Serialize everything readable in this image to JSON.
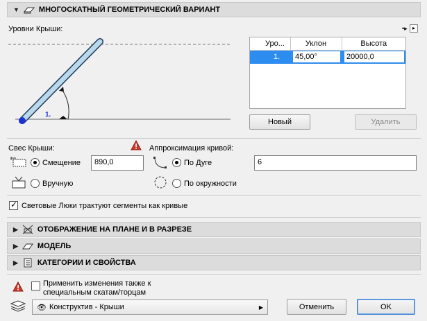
{
  "header": {
    "title": "МНОГОСКАТНЫЙ ГЕОМЕТРИЧЕСКИЙ ВАРИАНТ"
  },
  "levels": {
    "label": "Уровни Крыши:",
    "diagram_level": "1.",
    "table": {
      "columns": [
        "Уро...",
        "Уклон",
        "Высота"
      ],
      "rows": [
        {
          "num": "1.",
          "slope": "45,00°",
          "height": "20000,0"
        }
      ]
    },
    "new_button": "Новый",
    "delete_button": "Удалить"
  },
  "overhang": {
    "label": "Свес Крыши:",
    "offset_label": "Смещение",
    "offset_value": "890,0",
    "manual_label": "Вручную"
  },
  "approx": {
    "label": "Аппроксимация кривой:",
    "arc_label": "По Дуге",
    "arc_value": "6",
    "circle_label": "По окружности"
  },
  "skylight_label": "Световые Люки трактуют сегменты как кривые",
  "sections": [
    {
      "label": "ОТОБРАЖЕНИЕ НА ПЛАНЕ И В РАЗРЕЗЕ",
      "icon": "plan-section-icon"
    },
    {
      "label": "МОДЕЛЬ",
      "icon": "model-icon"
    },
    {
      "label": "КАТЕГОРИИ И СВОЙСТВА",
      "icon": "categories-icon"
    }
  ],
  "footer": {
    "apply_label_line1": "Применить изменения также к",
    "apply_label_line2": "специальным скатам/торцам",
    "layer_value": "Конструктив - Крыши",
    "cancel_button": "Отменить",
    "ok_button": "OK"
  },
  "colors": {
    "warning": "#c0392b",
    "selection": "#2d8cf0",
    "roof_fill": "#b9d9ea",
    "roof_dot": "#1b32d6"
  }
}
